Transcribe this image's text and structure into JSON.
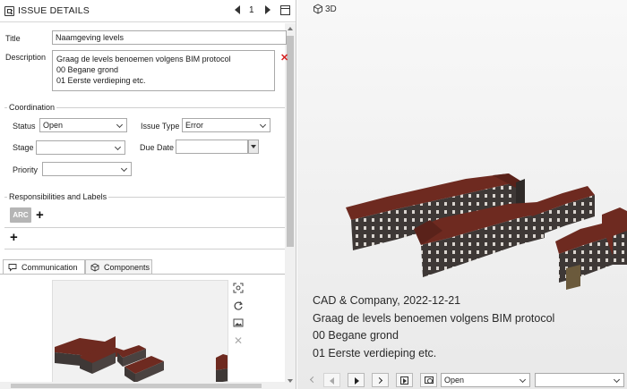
{
  "issue_panel": {
    "title": "ISSUE DETAILS",
    "page_number": "1",
    "title_label": "Title",
    "title_value": "Naamgeving levels",
    "description_label": "Description",
    "description_value": "Graag de levels benoemen volgens BIM protocol\n00 Begane grond\n01 Eerste verdieping etc.",
    "coordination": {
      "group_label": "Coordination",
      "status_label": "Status",
      "status_value": "Open",
      "issue_type_label": "Issue Type",
      "issue_type_value": "Error",
      "stage_label": "Stage",
      "stage_value": "",
      "due_date_label": "Due Date",
      "due_date_value": "",
      "priority_label": "Priority",
      "priority_value": ""
    },
    "responsibilities": {
      "group_label": "Responsibilities and Labels",
      "chip_label": "ARC"
    },
    "tabs": [
      {
        "label": "Communication",
        "icon": "speech-bubble-icon"
      },
      {
        "label": "Components",
        "icon": "box-icon"
      }
    ]
  },
  "view_panel": {
    "view_label": "3D",
    "caption_lines": [
      "CAD & Company, 2022-12-21",
      "Graag de levels benoemen volgens BIM protocol",
      "00 Begane grond",
      "01 Eerste verdieping etc."
    ],
    "status_select_value": "Open",
    "second_select_value": ""
  },
  "colors": {
    "roof": "#6e2a20",
    "wall": "#3e3836",
    "window": "#d9d4cf",
    "close_red": "#d41f1f"
  }
}
